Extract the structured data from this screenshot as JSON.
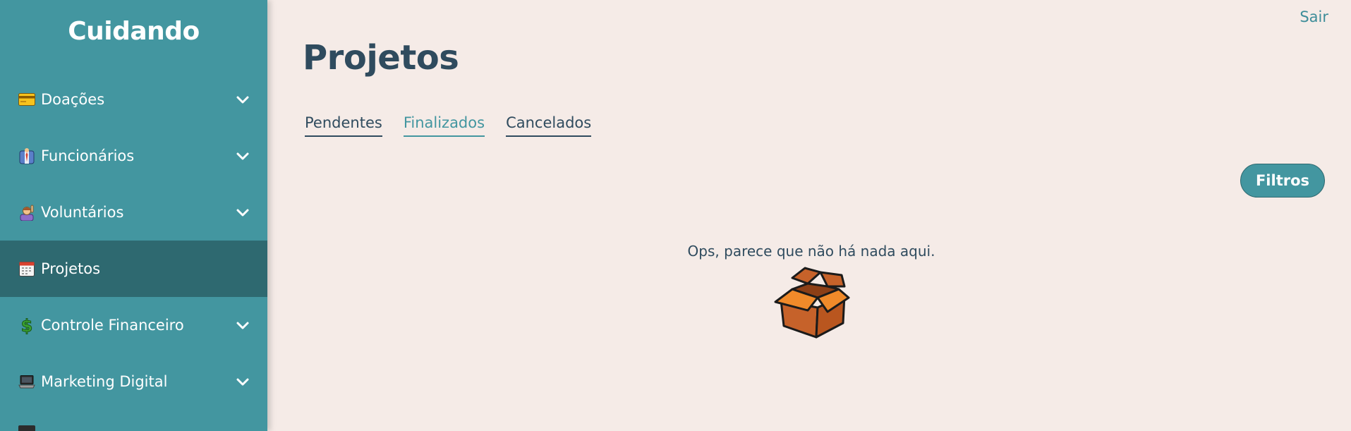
{
  "sidebar": {
    "brand": "Cuidando",
    "items": [
      {
        "label": "Doações",
        "icon": "credit-card-icon",
        "expandable": true,
        "active": false
      },
      {
        "label": "Funcionários",
        "icon": "worker-icon",
        "expandable": true,
        "active": false
      },
      {
        "label": "Voluntários",
        "icon": "raising-hand-icon",
        "expandable": true,
        "active": false
      },
      {
        "label": "Projetos",
        "icon": "calendar-icon",
        "expandable": false,
        "active": true
      },
      {
        "label": "Controle Financeiro",
        "icon": "dollar-icon",
        "expandable": true,
        "active": false
      },
      {
        "label": "Marketing Digital",
        "icon": "laptop-icon",
        "expandable": true,
        "active": false
      }
    ]
  },
  "header": {
    "logout_label": "Sair"
  },
  "main": {
    "title": "Projetos",
    "tabs": [
      {
        "label": "Pendentes",
        "active": false
      },
      {
        "label": "Finalizados",
        "active": true
      },
      {
        "label": "Cancelados",
        "active": false
      }
    ],
    "filters_label": "Filtros",
    "empty_message": "Ops, parece que não há nada aqui.",
    "empty_icon": "open-box-icon"
  },
  "colors": {
    "sidebar_bg": "#4396a0",
    "sidebar_active_bg": "#2e6970",
    "page_bg": "#f5ebe7",
    "text_dark": "#2f4b5e",
    "accent": "#4396a0"
  }
}
